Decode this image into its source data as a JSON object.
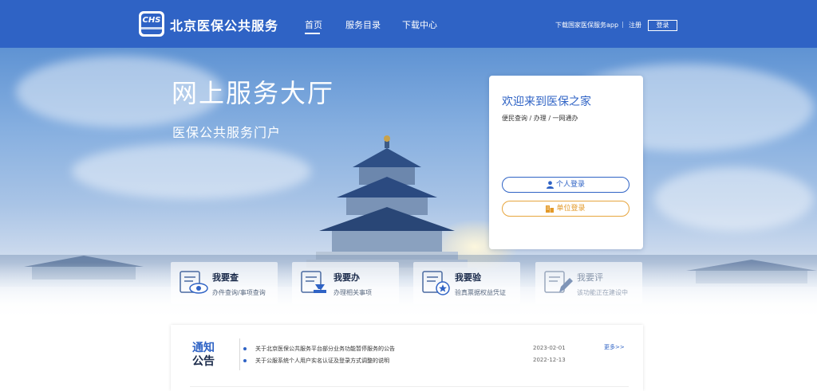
{
  "header": {
    "logo_text": "CHS",
    "site_title": "北京医保公共服务",
    "nav": [
      {
        "label": "首页",
        "active": true
      },
      {
        "label": "服务目录",
        "active": false
      },
      {
        "label": "下载中心",
        "active": false
      }
    ],
    "download_app": "下载国家医保服务app",
    "register": "注册",
    "login": "登录"
  },
  "hero": {
    "title": "网上服务大厅",
    "subtitle": "医保公共服务门户"
  },
  "welcome": {
    "title": "欢迎来到医保之家",
    "subtitle": "便民查询 / 办理 / 一网通办",
    "personal_login": "个人登录",
    "unit_login": "单位登录"
  },
  "services": [
    {
      "title": "我要查",
      "desc": "办件查询/事项查询",
      "icon": "eye-document-icon"
    },
    {
      "title": "我要办",
      "desc": "办理相关事项",
      "icon": "stamp-document-icon"
    },
    {
      "title": "我要验",
      "desc": "验真票据权益凭证",
      "icon": "star-badge-document-icon"
    },
    {
      "title": "我要评",
      "desc": "该功能正在建设中",
      "icon": "pen-document-icon"
    }
  ],
  "notice": {
    "title_line1": "通知",
    "title_line2": "公告",
    "more": "更多>>",
    "items": [
      {
        "text": "关于北京医保公共服务平台部分业务功能暂停服务的公告",
        "date": "2023-02-01"
      },
      {
        "text": "关于公服系统个人用户实名认证及登录方式调整的说明",
        "date": "2022-12-13"
      }
    ]
  },
  "colors": {
    "brand_blue": "#2f63c5",
    "unit_orange": "#e39a2a"
  }
}
